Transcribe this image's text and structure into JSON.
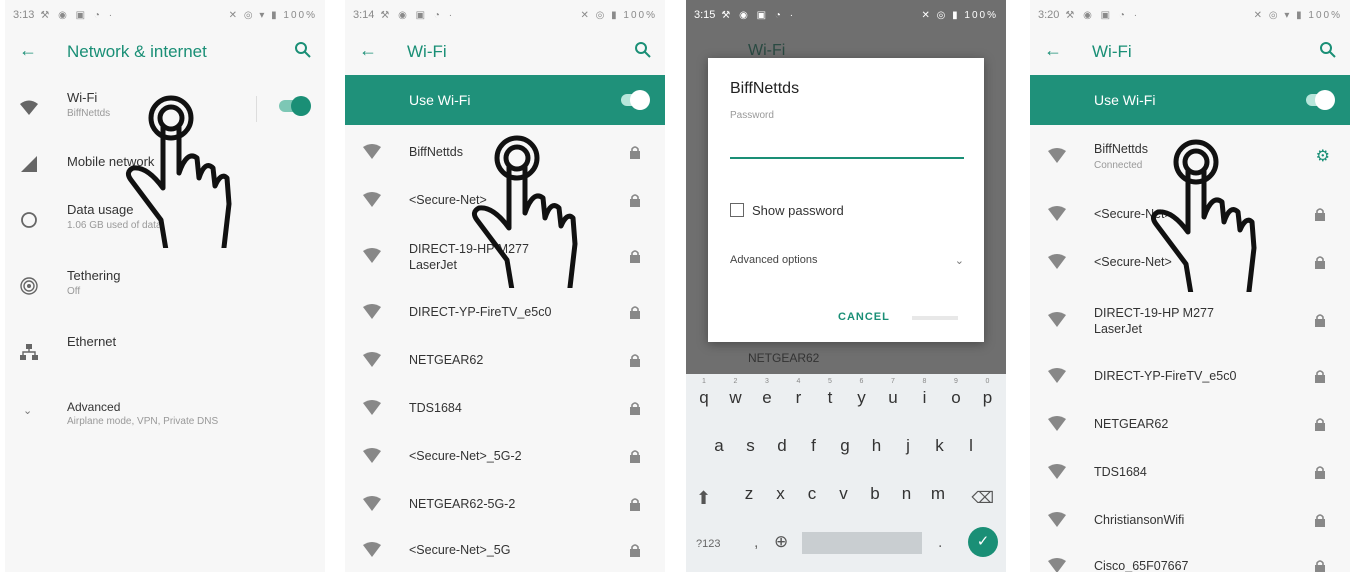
{
  "panel1": {
    "status_time": "3:13",
    "status_battery": "100%",
    "title": "Network & internet",
    "items": [
      {
        "label": "Wi-Fi",
        "sub": "BiffNettds"
      },
      {
        "label": "Mobile network",
        "sub": ""
      },
      {
        "label": "Data usage",
        "sub": "1.06 GB used of data"
      },
      {
        "label": "Tethering",
        "sub": "Off"
      },
      {
        "label": "Ethernet",
        "sub": ""
      },
      {
        "label": "Advanced",
        "sub": "Airplane mode, VPN, Private DNS"
      }
    ]
  },
  "panel2": {
    "status_time": "3:14",
    "status_battery": "100%",
    "title": "Wi-Fi",
    "use_wifi": "Use Wi-Fi",
    "networks": [
      {
        "name": "BiffNettds",
        "name2": ""
      },
      {
        "name": "<Secure-Net>",
        "name2": ""
      },
      {
        "name": "DIRECT-19-HP M277",
        "name2": "LaserJet"
      },
      {
        "name": "DIRECT-YP-FireTV_e5c0",
        "name2": ""
      },
      {
        "name": "NETGEAR62",
        "name2": ""
      },
      {
        "name": "TDS1684",
        "name2": ""
      },
      {
        "name": "<Secure-Net>_5G-2",
        "name2": ""
      },
      {
        "name": "NETGEAR62-5G-2",
        "name2": ""
      },
      {
        "name": "<Secure-Net>_5G",
        "name2": ""
      }
    ]
  },
  "panel3": {
    "status_time": "3:15",
    "status_battery": "100%",
    "behind_title": "Wi-Fi",
    "behind_network": "NETGEAR62",
    "dialog_title": "BiffNettds",
    "password_label": "Password",
    "show_password": "Show password",
    "advanced_options": "Advanced options",
    "cancel": "CANCEL",
    "keyboard": {
      "row1": [
        "q",
        "w",
        "e",
        "r",
        "t",
        "y",
        "u",
        "i",
        "o",
        "p"
      ],
      "row1_nums": [
        "1",
        "2",
        "3",
        "4",
        "5",
        "6",
        "7",
        "8",
        "9",
        "0"
      ],
      "row2": [
        "a",
        "s",
        "d",
        "f",
        "g",
        "h",
        "j",
        "k",
        "l"
      ],
      "row3": [
        "z",
        "x",
        "c",
        "v",
        "b",
        "n",
        "m"
      ],
      "symbols": "?123",
      "comma": ",",
      "period": "."
    }
  },
  "panel4": {
    "status_time": "3:20",
    "status_battery": "100%",
    "title": "Wi-Fi",
    "use_wifi": "Use Wi-Fi",
    "networks": [
      {
        "name": "BiffNettds",
        "name2": "Connected"
      },
      {
        "name": "<Secure-Net>",
        "name2": ""
      },
      {
        "name": "<Secure-Net>",
        "name2": ""
      },
      {
        "name": "DIRECT-19-HP M277",
        "name2": "LaserJet"
      },
      {
        "name": "DIRECT-YP-FireTV_e5c0",
        "name2": ""
      },
      {
        "name": "NETGEAR62",
        "name2": ""
      },
      {
        "name": "TDS1684",
        "name2": ""
      },
      {
        "name": "ChristiansonWifi",
        "name2": ""
      },
      {
        "name": "Cisco_65F07667",
        "name2": ""
      }
    ]
  },
  "colors": {
    "accent": "#1a8f76",
    "banner": "#1f917a"
  }
}
